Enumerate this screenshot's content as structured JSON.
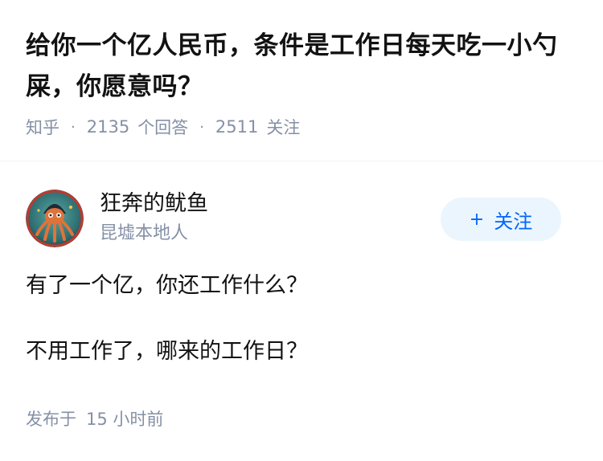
{
  "question": {
    "title": "给你一个亿人民币，条件是工作日每天吃一小勺屎，你愿意吗？",
    "source": "知乎",
    "separator": "·",
    "answer_count": "2135",
    "answer_label": "个回答",
    "follower_count": "2511",
    "follower_label": "关注"
  },
  "answer": {
    "author": {
      "name": "狂奔的鱿鱼",
      "bio": "昆墟本地人",
      "avatar_icon": "octopus-avatar-icon"
    },
    "follow_button": {
      "plus": "+",
      "label": "关注"
    },
    "paragraphs": [
      "有了一个亿，你还工作什么？",
      "不用工作了，哪来的工作日？"
    ],
    "published_label": "发布于",
    "published_time": "15 小时前"
  },
  "colors": {
    "text": "#121212",
    "muted": "#8590a6",
    "accent": "#0066ff",
    "button_bg": "#ebf5fd"
  }
}
